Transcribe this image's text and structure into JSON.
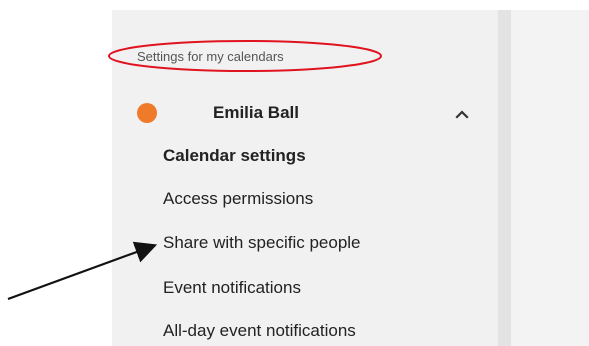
{
  "sidebar": {
    "section_title": "Settings for my calendars",
    "calendar": {
      "name": "Emilia Ball",
      "color": "#ef7a2a",
      "expand_icon": "chevron-up-icon"
    },
    "items": [
      {
        "label": "Calendar settings",
        "selected": true
      },
      {
        "label": "Access permissions"
      },
      {
        "label": "Share with specific people"
      },
      {
        "label": "Event notifications"
      },
      {
        "label": "All-day event notifications"
      }
    ]
  },
  "annotation": {
    "highlight_color": "#e0141e",
    "arrow_color": "#111111"
  }
}
